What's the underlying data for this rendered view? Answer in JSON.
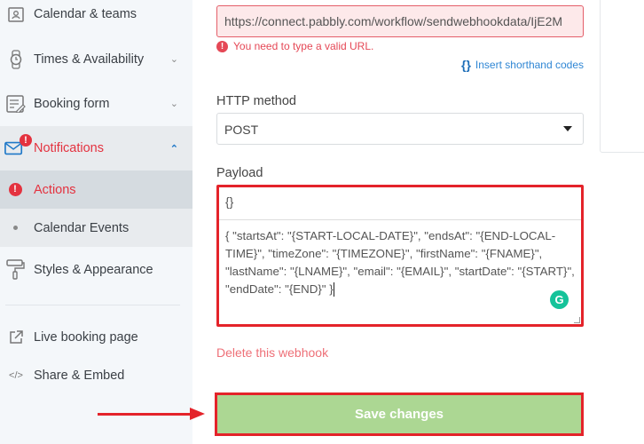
{
  "sidebar": {
    "items": [
      {
        "label": "Calendar & teams",
        "icon": "calendar-user-icon"
      },
      {
        "label": "Times & Availability",
        "icon": "watch-icon"
      },
      {
        "label": "Booking form",
        "icon": "form-edit-icon"
      },
      {
        "label": "Notifications",
        "icon": "envelope-icon",
        "badge": "!"
      },
      {
        "label": "Actions",
        "icon": "error-icon"
      },
      {
        "label": "Calendar Events",
        "icon": "bullet-icon"
      },
      {
        "label": "Styles & Appearance",
        "icon": "paint-roller-icon"
      },
      {
        "label": "Live booking page",
        "icon": "external-link-icon"
      },
      {
        "label": "Share & Embed",
        "icon": "code-icon"
      }
    ]
  },
  "form": {
    "url_value": "https://connect.pabbly.com/workflow/sendwebhookdata/IjE2M",
    "url_error": "You need to type a valid URL.",
    "insert_codes": "Insert shorthand codes",
    "http_label": "HTTP method",
    "http_value": "POST",
    "payload_label": "Payload",
    "payload_format": "{}",
    "payload_value": "{ \"startsAt\": \"{START-LOCAL-DATE}\", \"endsAt\": \"{END-LOCAL-TIME}\", \"timeZone\": \"{TIMEZONE}\", \"firstName\": \"{FNAME}\", \"lastName\": \"{LNAME}\", \"email\": \"{EMAIL}\", \"startDate\": \"{START}\", \"endDate\": \"{END}\" }",
    "delete_label": "Delete this webhook",
    "save_label": "Save changes"
  },
  "colors": {
    "error": "#e54856",
    "save": "#acd793",
    "highlight": "#e4232a",
    "link": "#2f86d4"
  }
}
